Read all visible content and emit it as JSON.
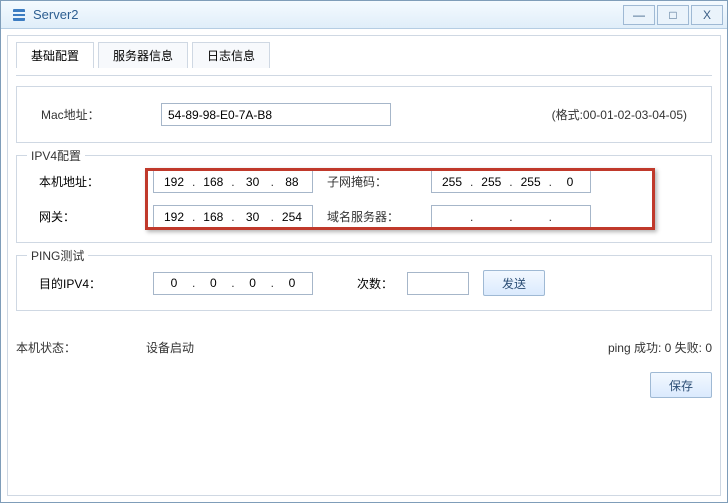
{
  "window": {
    "title": "Server2",
    "min_glyph": "—",
    "max_glyph": "□",
    "close_glyph": "X"
  },
  "tabs": {
    "basic": "基础配置",
    "server": "服务器信息",
    "log": "日志信息"
  },
  "mac": {
    "label": "Mac地址：",
    "value": "54-89-98-E0-7A-B8",
    "hint": "(格式:00-01-02-03-04-05)"
  },
  "ipv4": {
    "legend": "IPV4配置",
    "local_label": "本机地址：",
    "local": {
      "o1": "192",
      "o2": "168",
      "o3": "30",
      "o4": "88"
    },
    "mask_label": "子网掩码：",
    "mask": {
      "o1": "255",
      "o2": "255",
      "o3": "255",
      "o4": "0"
    },
    "gw_label": "网关：",
    "gw": {
      "o1": "192",
      "o2": "168",
      "o3": "30",
      "o4": "254"
    },
    "dns_label": "域名服务器：",
    "dns": {
      "o1": "",
      "o2": "",
      "o3": "",
      "o4": ""
    }
  },
  "ping": {
    "legend": "PING测试",
    "target_label": "目的IPV4：",
    "target": {
      "o1": "0",
      "o2": "0",
      "o3": "0",
      "o4": "0"
    },
    "count_label": "次数：",
    "count_value": "",
    "send_label": "发送"
  },
  "status": {
    "local_label": "本机状态：",
    "local_value": "设备启动",
    "ping_result": "ping 成功: 0 失败: 0"
  },
  "save_label": "保存"
}
